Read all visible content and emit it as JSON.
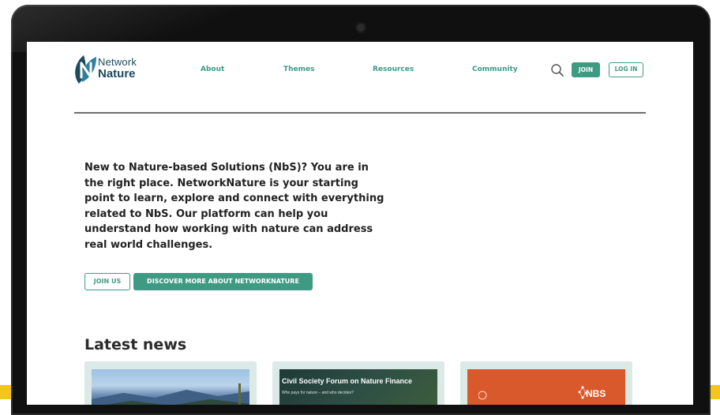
{
  "brand": {
    "line1": "Network",
    "line2": "Nature"
  },
  "nav": {
    "about": "About",
    "themes": "Themes",
    "resources": "Resources",
    "community": "Community"
  },
  "header_buttons": {
    "join": "JOIN",
    "login": "LOG IN"
  },
  "intro": {
    "text": "New to Nature-based Solutions (NbS)? You are in the right place. NetworkNature is your starting point to learn, explore and connect with everything related to NbS. Our platform can help you understand how working with nature can address real world challenges."
  },
  "cta": {
    "join_us": "JOIN US",
    "discover": "DISCOVER MORE ABOUT NETWORKNATURE"
  },
  "news": {
    "heading": "Latest news",
    "cards": [
      {
        "title": ""
      },
      {
        "title": "Civil Society Forum on Nature Finance",
        "subtitle": "Who pays for nature – and who decides?"
      },
      {
        "title": "NBS"
      }
    ]
  },
  "colors": {
    "accent": "#3f9a84",
    "brand_dark": "#1d4a5f",
    "card_bg": "#dbeae6",
    "bezel": "#101010",
    "highlight": "#f4c51a"
  },
  "icons": {
    "search": "search-icon",
    "logo": "leaf-n-logo-icon"
  }
}
